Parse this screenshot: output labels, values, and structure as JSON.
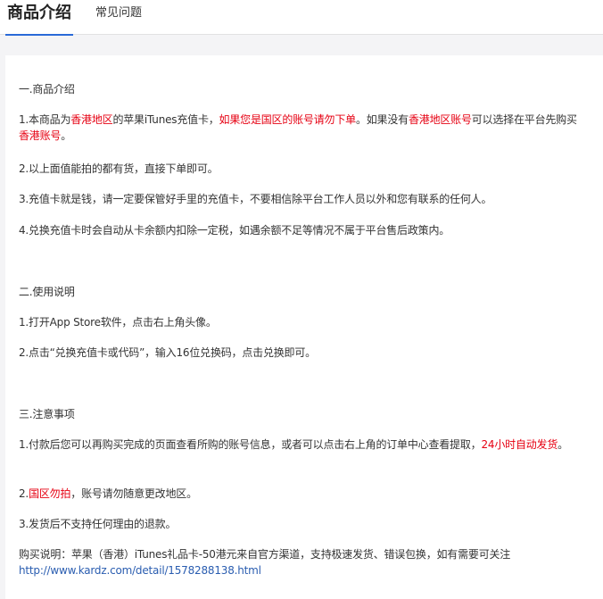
{
  "tabs": {
    "product_intro": "商品介绍",
    "faq": "常见问题"
  },
  "section1": {
    "title": "一.商品介绍",
    "p1": {
      "a": "1.本商品为",
      "b": "香港地区",
      "c": "的苹果iTunes充值卡，",
      "d": "如果您是国区的账号请勿下单",
      "e": "。如果没有",
      "f": "香港地区账号",
      "g": "可以选择在平台先购买",
      "h": "香港账号",
      "i": "。"
    },
    "p2": "2.以上面值能拍的都有货，直接下单即可。",
    "p3": "3.充值卡就是钱，请一定要保管好手里的充值卡，不要相信除平台工作人员以外和您有联系的任何人。",
    "p4": "4.兑换充值卡时会自动从卡余额内扣除一定税，如遇余额不足等情况不属于平台售后政策内。"
  },
  "section2": {
    "title": "二.使用说明",
    "p1": "1.打开App Store软件，点击右上角头像。",
    "p2": "2.点击“兑换充值卡或代码”，输入16位兑换码，点击兑换即可。"
  },
  "section3": {
    "title": "三.注意事项",
    "p1": {
      "a": "1.付款后您可以再购买完成的页面查看所购的账号信息，或者可以点击右上角的订单中心查看提取，",
      "b": "24小时自动发货",
      "c": "。"
    },
    "p2": {
      "a": "2.",
      "b": "国区勿拍",
      "c": "，账号请勿随意更改地区。"
    },
    "p3": "3.发货后不支持任何理由的退款。"
  },
  "purchase_note": {
    "text": "购买说明：苹果（香港）iTunes礼品卡-50港元来自官方渠道，支持极速发货、错误包换，如有需要可关注",
    "link": "http://www.kardz.com/detail/1578288138.html"
  },
  "colors": {
    "accent_red": "#e60012",
    "link_blue": "#2a5db0",
    "tab_underline": "#2a6ad8"
  }
}
